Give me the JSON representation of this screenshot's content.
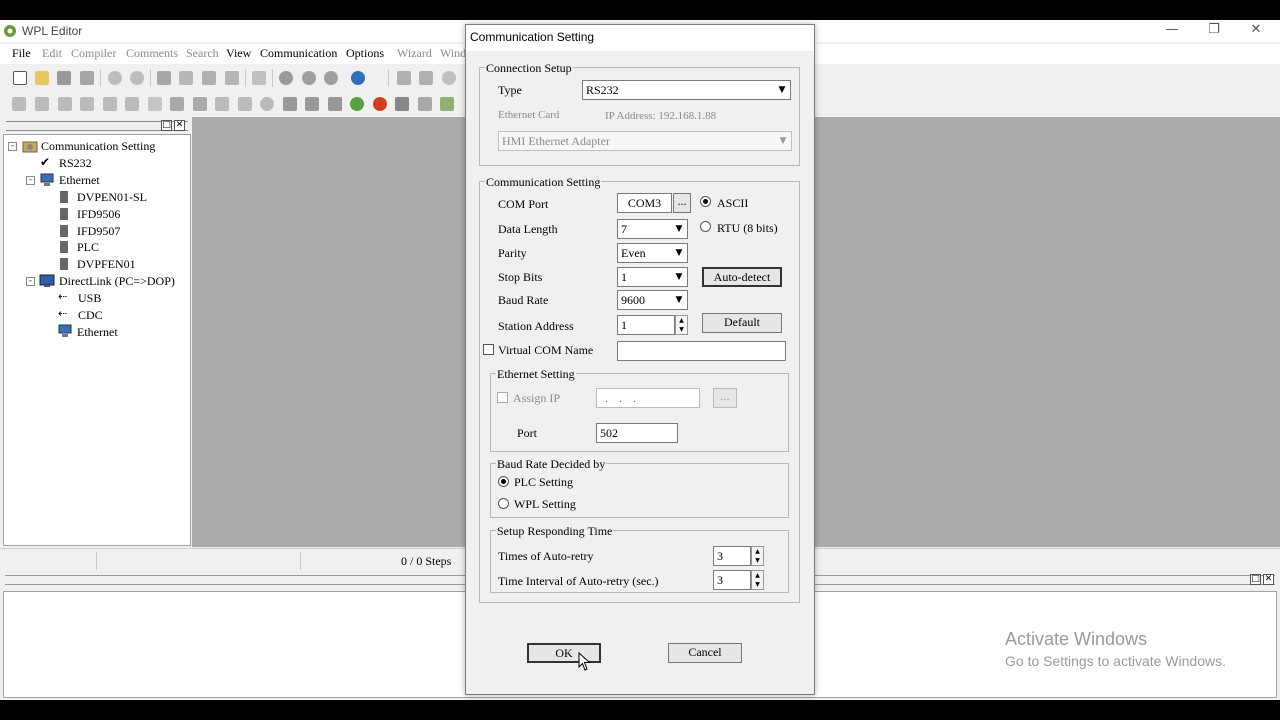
{
  "app": {
    "title": "WPL Editor",
    "menu": [
      {
        "label": "File",
        "disabled": false
      },
      {
        "label": "Edit",
        "disabled": true
      },
      {
        "label": "Compiler",
        "disabled": true
      },
      {
        "label": "Comments",
        "disabled": true
      },
      {
        "label": "Search",
        "disabled": true
      },
      {
        "label": "View",
        "disabled": false
      },
      {
        "label": "Communication",
        "disabled": false
      },
      {
        "label": "Options",
        "disabled": false
      },
      {
        "label": "Wizard",
        "disabled": true
      },
      {
        "label": "Wind",
        "disabled": true
      }
    ]
  },
  "tree": {
    "root": "Communication Setting",
    "items": [
      {
        "label": "RS232",
        "icon": "check-icon"
      },
      {
        "label": "Ethernet",
        "icon": "network-icon"
      },
      {
        "label": "DVPEN01-SL",
        "icon": "device-icon"
      },
      {
        "label": "IFD9506",
        "icon": "device-icon"
      },
      {
        "label": "IFD9507",
        "icon": "device-icon"
      },
      {
        "label": "PLC",
        "icon": "device-icon"
      },
      {
        "label": "DVPFEN01",
        "icon": "device-icon"
      },
      {
        "label": "DirectLink (PC=>DOP)",
        "icon": "monitor-icon"
      },
      {
        "label": "USB",
        "icon": "usb-icon"
      },
      {
        "label": "CDC",
        "icon": "usb-icon"
      },
      {
        "label": "Ethernet",
        "icon": "network-icon"
      }
    ]
  },
  "status": {
    "steps": "0 / 0 Steps"
  },
  "watermark": {
    "line1": "Activate Windows",
    "line2": "Go to Settings to activate Windows."
  },
  "dialog": {
    "title": "Communication Setting",
    "connection_setup": {
      "group_label": "Connection Setup",
      "type_label": "Type",
      "type_value": "RS232",
      "ethernet_card_label": "Ethernet Card",
      "ip_address": "IP Address: 192.168.1.88",
      "adapter_value": "HMI Ethernet Adapter"
    },
    "comm_setting": {
      "group_label": "Communication Setting",
      "com_port_label": "COM Port",
      "com_port_value": "COM3",
      "browse_label": "...",
      "ascii_label": "ASCII",
      "rtu_label": "RTU (8 bits)",
      "mode_selected": "ASCII",
      "data_length_label": "Data Length",
      "data_length_value": "7",
      "parity_label": "Parity",
      "parity_value": "Even",
      "stop_bits_label": "Stop Bits",
      "stop_bits_value": "1",
      "baud_rate_label": "Baud Rate",
      "baud_rate_value": "9600",
      "station_label": "Station Address",
      "station_value": "1",
      "auto_detect_label": "Auto-detect",
      "default_label": "Default",
      "virtual_com_label": "Virtual COM Name",
      "virtual_com_value": ""
    },
    "ethernet_setting": {
      "group_label": "Ethernet Setting",
      "assign_ip_label": "Assign IP",
      "ip_value": ". . .",
      "browse_label": "...",
      "port_label": "Port",
      "port_value": "502"
    },
    "baud_decided": {
      "group_label": "Baud Rate Decided by",
      "plc_label": "PLC Setting",
      "wpl_label": "WPL Setting",
      "selected": "PLC Setting"
    },
    "responding": {
      "group_label": "Setup Responding Time",
      "retry_label": "Times of Auto-retry",
      "retry_value": "3",
      "interval_label": "Time Interval of Auto-retry (sec.)",
      "interval_value": "3"
    },
    "ok_label": "OK",
    "cancel_label": "Cancel"
  }
}
